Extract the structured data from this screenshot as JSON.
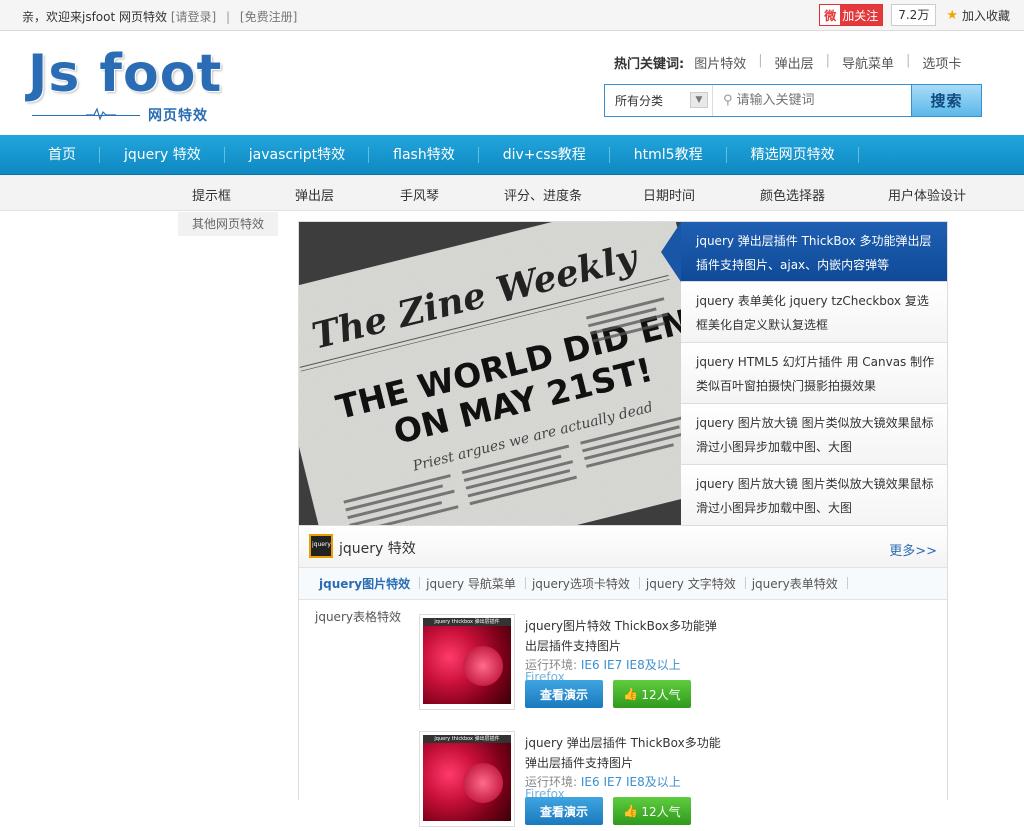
{
  "topbar": {
    "welcome": "亲，欢迎来jsfoot 网页特效",
    "login": "[请登录]",
    "divider": "|",
    "register": "[免费注册]",
    "weibo_icon": "微",
    "weibo_follow": "加关注",
    "followers": "7.2万",
    "favorite": "加入收藏"
  },
  "logo": {
    "title": "Js foot",
    "subtitle": "网页特效"
  },
  "hotwords": {
    "label": "热门关键词:",
    "items": [
      "图片特效",
      "弹出层",
      "导航菜单",
      "选项卡"
    ]
  },
  "search": {
    "category": "所有分类",
    "placeholder": "请输入关键词",
    "button": "搜索"
  },
  "mainnav": {
    "items": [
      "首页",
      "jquery 特效",
      "javascript特效",
      "flash特效",
      "div+css教程",
      "html5教程",
      "精选网页特效"
    ]
  },
  "subnav": {
    "items": [
      "提示框",
      "弹出层",
      "手风琴",
      "评分、进度条",
      "日期时间",
      "颜色选择器",
      "用户体验设计"
    ],
    "extra": "其他网页特效"
  },
  "slider": {
    "image": {
      "masthead": "The Zine Weekly",
      "headline1": "THE WORLD DID END",
      "headline2": "ON MAY 21ST!",
      "tagline": "Priest argues we are actually dead"
    },
    "items": [
      "jquery 弹出层插件 ThickBox 多功能弹出层插件支持图片、ajax、内嵌内容弹等",
      "jquery 表单美化 jquery tzCheckbox 复选框美化自定义默认复选框",
      "jquery HTML5 幻灯片插件 用 Canvas 制作类似百叶窗拍摄快门摄影拍摄效果",
      "jquery 图片放大镜 图片类似放大镜效果鼠标滑过小图异步加载中图、大图",
      "jquery 图片放大镜 图片类似放大镜效果鼠标滑过小图异步加载中图、大图"
    ]
  },
  "section": {
    "title": "jquery 特效",
    "more": "更多>>",
    "tabs": [
      "jquery图片特效",
      "jquery 导航菜单",
      "jquery选项卡特效",
      "jquery 文字特效",
      "jquery表单特效"
    ],
    "side": "jquery表格特效",
    "cards": [
      {
        "thumb_label": "jquery thickbox 弹出层插件",
        "desc": "jquery图片特效 ThickBox多功能弹出层插件支持图片",
        "env_label": "运行环境:",
        "env_values": "IE6 IE7 IE8及以上",
        "firefox": "Firefox",
        "demo": "查看演示",
        "popularity": "12人气"
      },
      {
        "thumb_label": "jquery thickbox 弹出层插件",
        "desc": "jquery 弹出层插件 ThickBox多功能弹出层插件支持图片",
        "env_label": "运行环境:",
        "env_values": "IE6 IE7 IE8及以上",
        "firefox": "Firefox",
        "demo": "查看演示",
        "popularity": "12人气"
      }
    ]
  }
}
